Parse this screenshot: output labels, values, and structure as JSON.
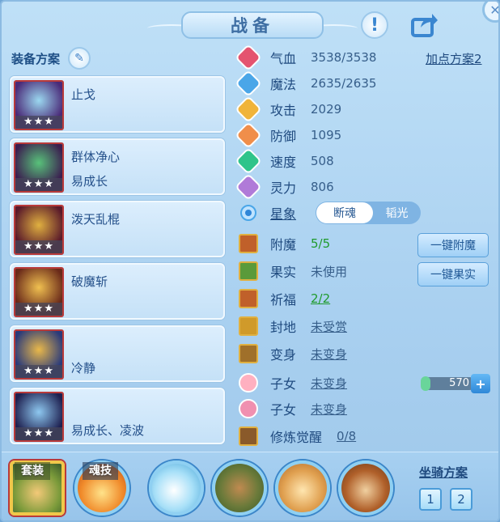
{
  "header": {
    "title": "战备",
    "help_label": "!",
    "share_icon": "share-icon",
    "close_icon": "close-icon"
  },
  "equipment": {
    "title": "装备方案",
    "items": [
      {
        "name": "止戈",
        "sub": "",
        "stars": "★★★",
        "colors": [
          "#4a2a78",
          "#9bd8f0"
        ]
      },
      {
        "name": "群体净心",
        "sub": "易成长",
        "stars": "★★★",
        "colors": [
          "#3b1f50",
          "#58c27a"
        ]
      },
      {
        "name": "泼天乱棍",
        "sub": "",
        "stars": "★★★",
        "colors": [
          "#5a1a2a",
          "#e0b040"
        ]
      },
      {
        "name": "破魔斩",
        "sub": "",
        "stars": "★★★",
        "colors": [
          "#6a2a1a",
          "#f0c050"
        ]
      },
      {
        "name": "",
        "sub": "冷静",
        "stars": "★★★",
        "colors": [
          "#2a3a7a",
          "#e9b84a"
        ]
      },
      {
        "name": "",
        "sub": "易成长、凌波",
        "stars": "★★★",
        "colors": [
          "#1e2050",
          "#8ec8f0"
        ]
      }
    ]
  },
  "stats": {
    "plan_link": "加点方案2",
    "rows": [
      {
        "label": "气血",
        "value": "3538/3538",
        "icon": "heart-icon",
        "color": "#e4536f"
      },
      {
        "label": "魔法",
        "value": "2635/2635",
        "icon": "mana-icon",
        "color": "#4aa6e8"
      },
      {
        "label": "攻击",
        "value": "2029",
        "icon": "attack-icon",
        "color": "#f0b43a"
      },
      {
        "label": "防御",
        "value": "1095",
        "icon": "defense-icon",
        "color": "#f08e4a"
      },
      {
        "label": "速度",
        "value": "508",
        "icon": "speed-icon",
        "color": "#2fc48a"
      },
      {
        "label": "灵力",
        "value": "806",
        "icon": "spirit-icon",
        "color": "#b07ad8"
      }
    ],
    "star_label": "星象",
    "star_options": [
      "断魂",
      "韬光"
    ],
    "extra": [
      {
        "label": "附魔",
        "value": "5/5",
        "icon": "enchant-icon"
      },
      {
        "label": "果实",
        "value": "未使用",
        "icon": "fruit-icon"
      },
      {
        "label": "祈福",
        "value": "2/2",
        "icon": "blessing-icon"
      },
      {
        "label": "封地",
        "value": "未受赏",
        "icon": "fief-icon"
      },
      {
        "label": "变身",
        "value": "未变身",
        "icon": "transform-icon"
      },
      {
        "label": "子女",
        "value": "未变身",
        "icon": "child-boy-icon"
      },
      {
        "label": "子女",
        "value": "未变身",
        "icon": "child-girl-icon"
      },
      {
        "label": "修炼觉醒",
        "value": "0/8",
        "icon": "cultivation-icon"
      }
    ],
    "btn_enchant": "一键附魔",
    "btn_fruit": "一键果实",
    "currency_value": "570"
  },
  "bottom": {
    "tag_suit": "套装",
    "tag_soul": "魂技",
    "mount_title": "坐骑方案",
    "mount_1": "1",
    "mount_2": "2"
  }
}
